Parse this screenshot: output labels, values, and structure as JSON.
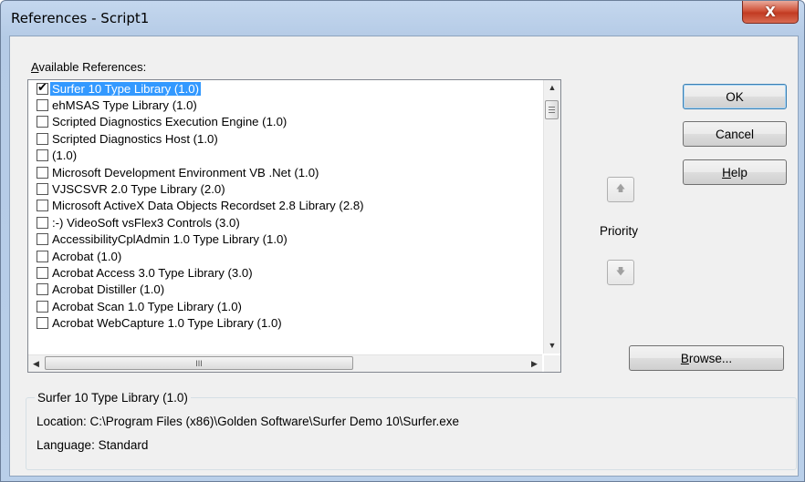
{
  "window": {
    "title": "References - Script1",
    "close_glyph": "X"
  },
  "available_label_underlined": "A",
  "available_label_rest": "vailable References:",
  "references": [
    {
      "label": "Surfer 10 Type Library (1.0)",
      "checked": true,
      "selected": true
    },
    {
      "label": "ehMSAS Type Library (1.0)",
      "checked": false,
      "selected": false
    },
    {
      "label": "Scripted Diagnostics Execution Engine (1.0)",
      "checked": false,
      "selected": false
    },
    {
      "label": "Scripted Diagnostics Host (1.0)",
      "checked": false,
      "selected": false
    },
    {
      "label": " (1.0)",
      "checked": false,
      "selected": false
    },
    {
      "label": "Microsoft Development Environment VB .Net (1.0)",
      "checked": false,
      "selected": false
    },
    {
      "label": "VJSCSVR 2.0 Type Library (2.0)",
      "checked": false,
      "selected": false
    },
    {
      "label": "Microsoft ActiveX Data Objects Recordset 2.8 Library (2.8)",
      "checked": false,
      "selected": false
    },
    {
      "label": ":-) VideoSoft vsFlex3 Controls (3.0)",
      "checked": false,
      "selected": false
    },
    {
      "label": "AccessibilityCplAdmin 1.0 Type Library (1.0)",
      "checked": false,
      "selected": false
    },
    {
      "label": "Acrobat (1.0)",
      "checked": false,
      "selected": false
    },
    {
      "label": "Acrobat Access 3.0 Type Library (3.0)",
      "checked": false,
      "selected": false
    },
    {
      "label": "Acrobat Distiller (1.0)",
      "checked": false,
      "selected": false
    },
    {
      "label": "Acrobat Scan 1.0 Type Library (1.0)",
      "checked": false,
      "selected": false
    },
    {
      "label": "Acrobat WebCapture 1.0 Type Library (1.0)",
      "checked": false,
      "selected": false
    }
  ],
  "buttons": {
    "ok": "OK",
    "cancel": "Cancel",
    "help_underlined": "H",
    "help_rest": "elp",
    "browse_underlined": "B",
    "browse_rest": "rowse..."
  },
  "priority": {
    "label": "Priority",
    "up_icon": "up-arrow-icon",
    "down_icon": "down-arrow-icon"
  },
  "scrollbars": {
    "thumb_grip": "III"
  },
  "details": {
    "selected_name": "Surfer 10 Type Library (1.0)",
    "location": "Location: C:\\Program Files (x86)\\Golden Software\\Surfer Demo 10\\Surfer.exe",
    "language": "Language: Standard"
  },
  "colors": {
    "selection": "#3399ff",
    "close_button": "#c23b22",
    "title_bar": "#b9cfe9"
  }
}
